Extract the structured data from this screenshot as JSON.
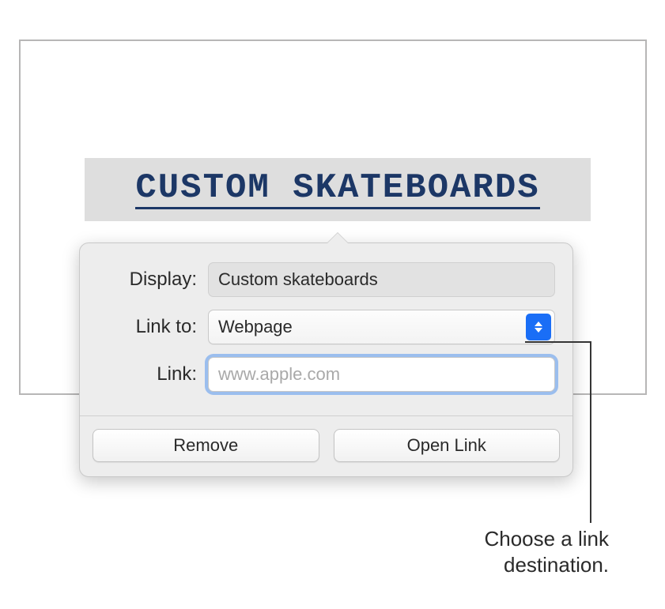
{
  "title_text": "CUSTOM SKATEBOARDS",
  "popover": {
    "labels": {
      "display": "Display:",
      "link_to": "Link to:",
      "link": "Link:"
    },
    "display_value": "Custom skateboards",
    "link_to_value": "Webpage",
    "link_value": "",
    "link_placeholder": "www.apple.com",
    "actions": {
      "remove": "Remove",
      "open": "Open Link"
    }
  },
  "callout": "Choose a link destination."
}
